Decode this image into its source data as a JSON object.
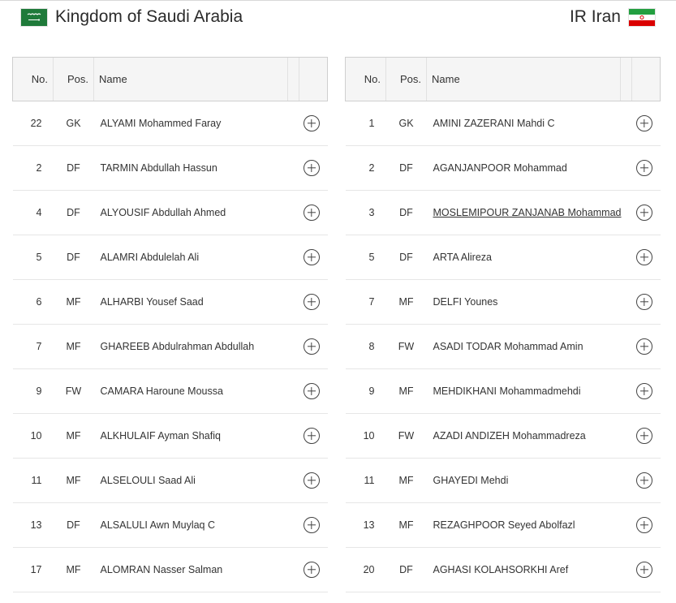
{
  "teams": {
    "home": {
      "name": "Kingdom of Saudi Arabia",
      "flag_colors": {
        "field": "#1f7a3a",
        "emblem": "#ffffff"
      }
    },
    "away": {
      "name": "IR Iran",
      "flag_colors": {
        "top": "#239f40",
        "middle": "#ffffff",
        "bottom": "#da0000",
        "emblem": "#da0000"
      }
    }
  },
  "columns": {
    "no": "No.",
    "pos": "Pos.",
    "name": "Name"
  },
  "home_players": [
    {
      "no": "22",
      "pos": "GK",
      "name": "ALYAMI Mohammed Faray"
    },
    {
      "no": "2",
      "pos": "DF",
      "name": "TARMIN Abdullah Hassun"
    },
    {
      "no": "4",
      "pos": "DF",
      "name": "ALYOUSIF Abdullah Ahmed"
    },
    {
      "no": "5",
      "pos": "DF",
      "name": "ALAMRI Abdulelah Ali"
    },
    {
      "no": "6",
      "pos": "MF",
      "name": "ALHARBI Yousef Saad"
    },
    {
      "no": "7",
      "pos": "MF",
      "name": "GHAREEB Abdulrahman Abdullah"
    },
    {
      "no": "9",
      "pos": "FW",
      "name": "CAMARA Haroune Moussa"
    },
    {
      "no": "10",
      "pos": "MF",
      "name": "ALKHULAIF Ayman Shafiq"
    },
    {
      "no": "11",
      "pos": "MF",
      "name": "ALSELOULI Saad Ali"
    },
    {
      "no": "13",
      "pos": "DF",
      "name": "ALSALULI Awn Muylaq C"
    },
    {
      "no": "17",
      "pos": "MF",
      "name": "ALOMRAN Nasser Salman"
    }
  ],
  "away_players": [
    {
      "no": "1",
      "pos": "GK",
      "name": "AMINI ZAZERANI Mahdi C"
    },
    {
      "no": "2",
      "pos": "DF",
      "name": "AGANJANPOOR Mohammad"
    },
    {
      "no": "3",
      "pos": "DF",
      "name": "MOSLEMIPOUR ZANJANAB Mohammad",
      "underlined": true
    },
    {
      "no": "5",
      "pos": "DF",
      "name": "ARTA Alireza"
    },
    {
      "no": "7",
      "pos": "MF",
      "name": "DELFI Younes"
    },
    {
      "no": "8",
      "pos": "FW",
      "name": "ASADI TODAR Mohammad Amin"
    },
    {
      "no": "9",
      "pos": "MF",
      "name": "MEHDIKHANI Mohammadmehdi"
    },
    {
      "no": "10",
      "pos": "FW",
      "name": "AZADI ANDIZEH Mohammadreza"
    },
    {
      "no": "11",
      "pos": "MF",
      "name": "GHAYEDI Mehdi"
    },
    {
      "no": "13",
      "pos": "MF",
      "name": "REZAGHPOOR Seyed Abolfazl"
    },
    {
      "no": "20",
      "pos": "DF",
      "name": "AGHASI KOLAHSORKHI Aref"
    }
  ],
  "icons": {
    "row_action": "plus-circle-icon",
    "home_flag": "saudi-arabia-flag-icon",
    "away_flag": "iran-flag-icon"
  }
}
